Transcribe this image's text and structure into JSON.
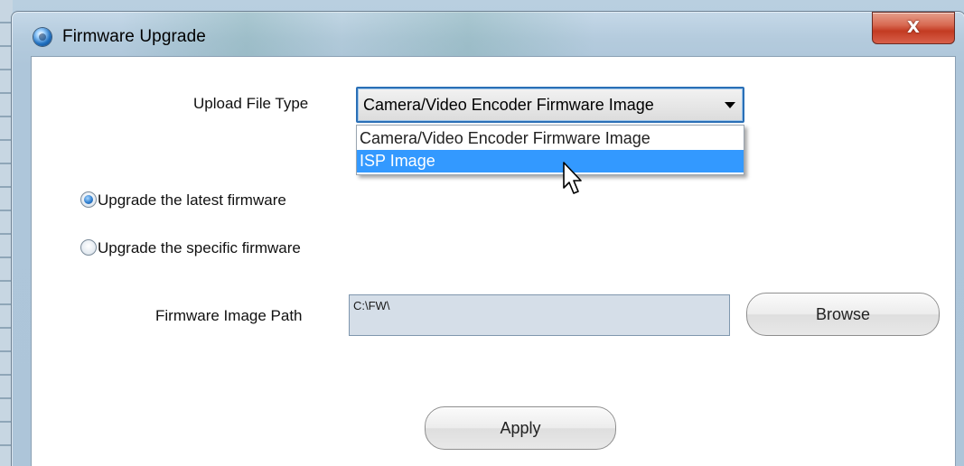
{
  "window": {
    "title": "Firmware Upgrade",
    "close_symbol": "X",
    "icon": "app-globe-icon"
  },
  "upload": {
    "label": "Upload File Type",
    "selected": "Camera/Video Encoder Firmware Image",
    "options": [
      "Camera/Video Encoder Firmware Image",
      "ISP Image"
    ],
    "highlighted_index": 1
  },
  "firmware_choice": {
    "latest_label": "Upgrade the latest firmware",
    "specific_label": "Upgrade the specific firmware",
    "selected": "latest"
  },
  "path": {
    "label": "Firmware Image Path",
    "value": "C:\\FW\\",
    "browse_label": "Browse"
  },
  "apply_label": "Apply",
  "colors": {
    "selection": "#3399ff",
    "close_button": "#c33b22",
    "path_field_bg": "#d5dee8"
  }
}
